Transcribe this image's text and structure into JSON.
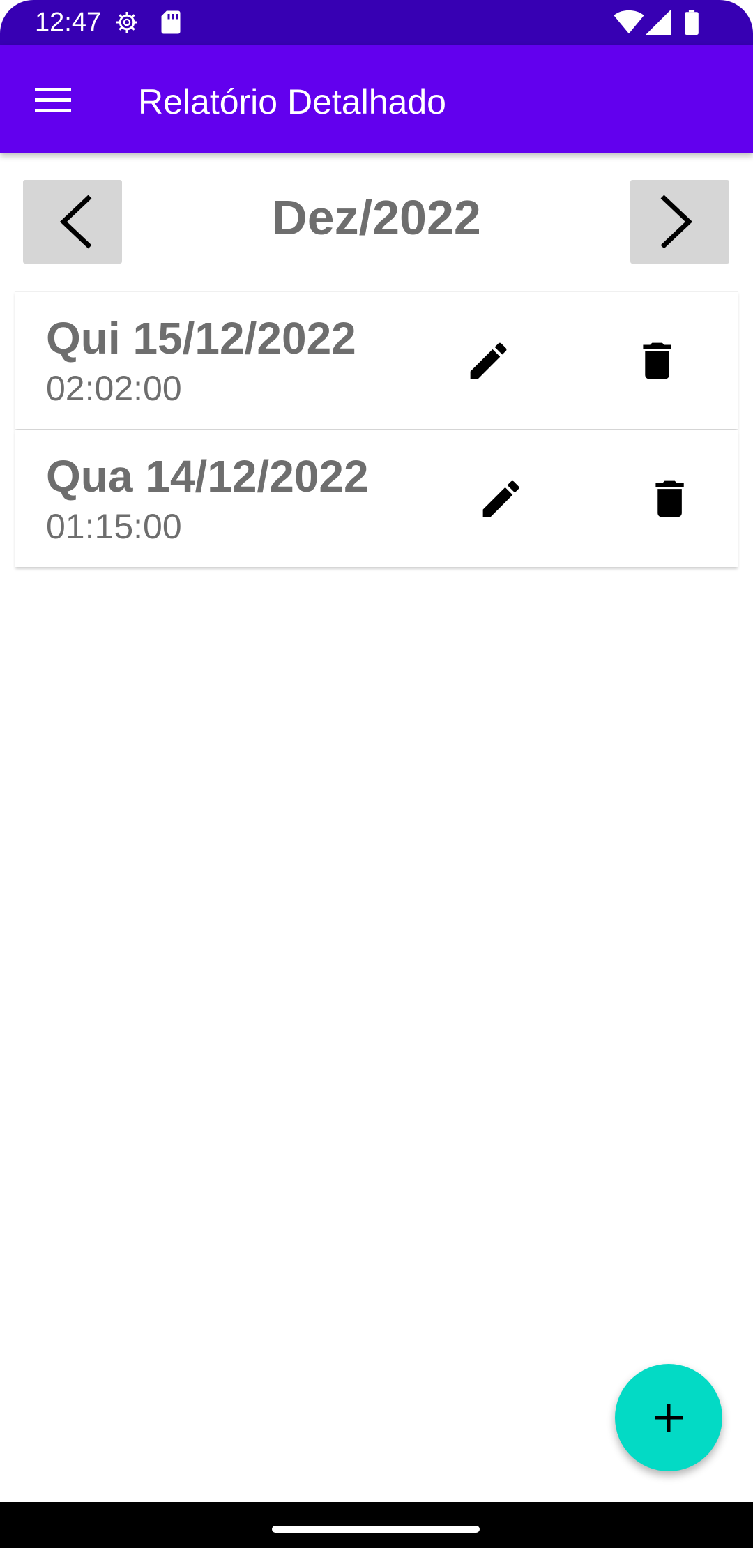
{
  "status_bar": {
    "time": "12:47",
    "icons": [
      "settings-gear-icon",
      "sd-card-icon",
      "wifi-icon",
      "cell-signal-icon",
      "battery-icon"
    ]
  },
  "app_bar": {
    "title": "Relatório Detalhado",
    "menu_icon": "hamburger-menu-icon",
    "color": "#6200ee"
  },
  "month_nav": {
    "label": "Dez/2022",
    "prev_icon": "chevron-left-icon",
    "next_icon": "chevron-right-icon"
  },
  "entries": [
    {
      "date": "Qui 15/12/2022",
      "duration": "02:02:00",
      "edit_icon": "pencil-icon",
      "delete_icon": "trash-icon"
    },
    {
      "date": "Qua 14/12/2022",
      "duration": "01:15:00",
      "edit_icon": "pencil-icon",
      "delete_icon": "trash-icon"
    }
  ],
  "fab": {
    "icon": "plus-icon",
    "color": "#03dac5"
  }
}
